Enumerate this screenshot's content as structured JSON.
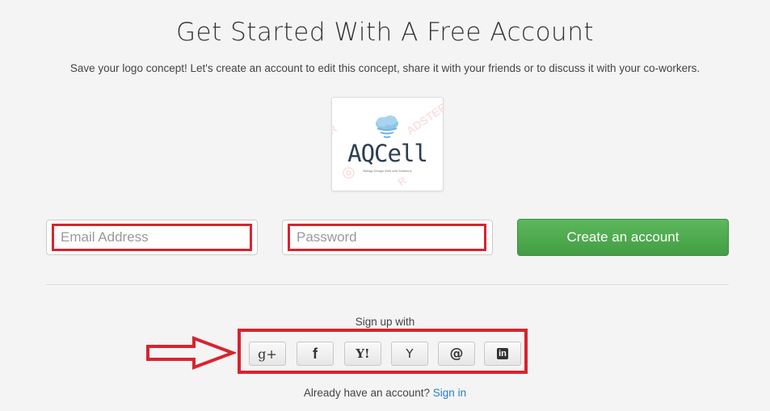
{
  "header": {
    "title": "Get Started With A Free Account",
    "subtitle": "Save your logo concept! Let's create an account to edit this concept, share it with your friends or to discuss it with your co-workers."
  },
  "logo": {
    "name": "AQCell",
    "tagline": "Bellagi Design Web and Solutions",
    "watermark": "R ADSTER",
    "cloud_icon": "cloud-icon"
  },
  "form": {
    "email_placeholder": "Email Address",
    "email_value": "",
    "password_placeholder": "Password",
    "password_value": "",
    "submit_label": "Create an account"
  },
  "social": {
    "label": "Sign up with",
    "buttons": [
      {
        "icon": "google-plus-icon",
        "glyph": "g+"
      },
      {
        "icon": "facebook-icon",
        "glyph": "f"
      },
      {
        "icon": "yahoo-icon",
        "glyph": "Y!"
      },
      {
        "icon": "hacker-news-icon",
        "glyph": "Y"
      },
      {
        "icon": "email-icon",
        "glyph": "@"
      },
      {
        "icon": "linkedin-icon",
        "glyph": "in"
      }
    ]
  },
  "footer": {
    "prompt": "Already have an account?",
    "signin_label": "Sign in"
  },
  "colors": {
    "highlight": "#d9232e",
    "button_green": "#5cb85c",
    "link": "#2a7fc1",
    "background": "#f4f4f4"
  }
}
